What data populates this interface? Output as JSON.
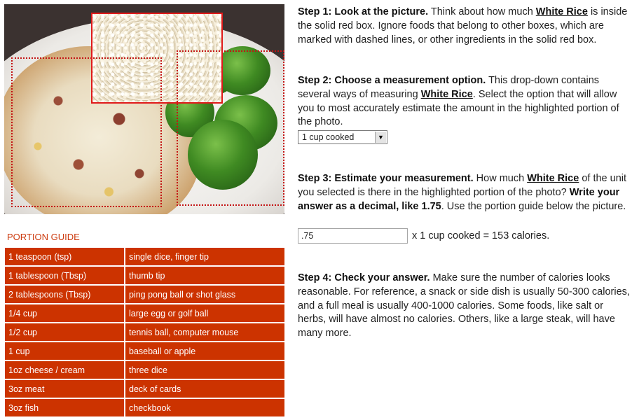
{
  "photo": {
    "highlight_food": "White Rice"
  },
  "portion_guide": {
    "title": "PORTION GUIDE",
    "rows": [
      [
        "1 teaspoon (tsp)",
        "single dice, finger tip"
      ],
      [
        "1 tablespoon (Tbsp)",
        "thumb tip"
      ],
      [
        "2 tablespoons (Tbsp)",
        "ping pong ball or shot glass"
      ],
      [
        "1/4 cup",
        "large egg or golf ball"
      ],
      [
        "1/2 cup",
        "tennis ball, computer mouse"
      ],
      [
        "1 cup",
        "baseball or apple"
      ],
      [
        "1oz cheese / cream",
        "three dice"
      ],
      [
        "3oz meat",
        "deck of cards"
      ],
      [
        "3oz fish",
        "checkbook"
      ]
    ]
  },
  "step1": {
    "title": "Step 1: Look at the picture.",
    "text_a": " Think about how much ",
    "food": "White Rice",
    "text_b": " is inside the solid red box. Ignore foods that belong to other boxes, which are marked with dashed lines, or other ingredients in the solid red box."
  },
  "step2": {
    "title": "Step 2: Choose a measurement option.",
    "text_a": " This drop-down contains several ways of measuring ",
    "food": "White Rice",
    "text_b": ". Select the option that will allow you to most accurately estimate the amount in the highlighted portion of the photo.",
    "select_value": "1 cup cooked"
  },
  "step3": {
    "title": "Step 3: Estimate your measurement.",
    "text_a": " How much ",
    "food": "White Rice",
    "text_b": " of the unit you selected is there in the highlighted portion of the photo? ",
    "bold_b": "Write your answer as a decimal, like 1.75",
    "text_c": ". Use the portion guide below the picture.",
    "input_value": ".75",
    "calc_text": "x 1 cup cooked = 153 calories."
  },
  "step4": {
    "title": "Step 4: Check your answer.",
    "text": " Make sure the number of calories looks reasonable. For reference, a snack or side dish is usually 50-300 calories, and a full meal is usually 400-1000 calories. Some foods, like salt or herbs, will have almost no calories. Others, like a large steak, will have many more."
  },
  "colors": {
    "accent_red": "#cc3300",
    "box_red": "#e01a1a"
  }
}
